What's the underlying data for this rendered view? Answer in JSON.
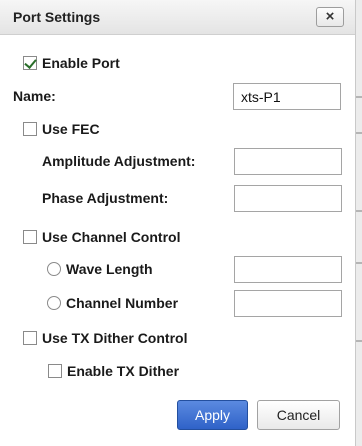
{
  "dialog": {
    "title": "Port Settings",
    "close_glyph": "×"
  },
  "enable_port": {
    "label": "Enable Port",
    "checked": true
  },
  "name": {
    "label": "Name:",
    "value": "xts-P1"
  },
  "use_fec": {
    "label": "Use FEC",
    "checked": false,
    "amplitude_label": "Amplitude Adjustment:",
    "amplitude_value": "",
    "phase_label": "Phase Adjustment:",
    "phase_value": ""
  },
  "use_channel_control": {
    "label": "Use Channel Control",
    "checked": false,
    "wave_length_label": "Wave Length",
    "wave_length_value": "",
    "channel_number_label": "Channel Number",
    "channel_number_value": ""
  },
  "use_tx_dither": {
    "label": "Use TX Dither Control",
    "checked": false,
    "enable_tx_dither_label": "Enable TX Dither",
    "enable_tx_dither_checked": false
  },
  "buttons": {
    "apply": "Apply",
    "cancel": "Cancel"
  },
  "colors": {
    "apply_button": "#3a6ed3",
    "checkmark": "#2a6e2a"
  }
}
